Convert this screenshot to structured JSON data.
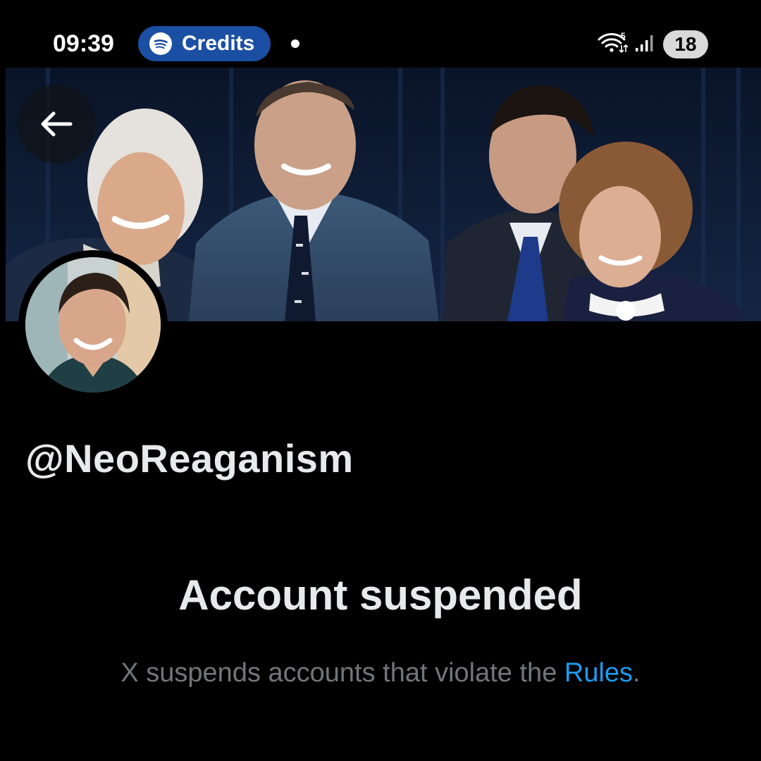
{
  "status_bar": {
    "time": "09:39",
    "media_pill_label": "Credits",
    "media_pill_icon": "spotify-icon",
    "network_label": "5",
    "battery_level": "18",
    "accent_color": "#1a4fa3"
  },
  "banner": {
    "back_icon": "arrow-left-icon"
  },
  "profile": {
    "handle": "@NeoReaganism"
  },
  "suspension": {
    "title": "Account suspended",
    "description_prefix": "X suspends accounts that violate the ",
    "rules_link": "Rules",
    "description_suffix": ".",
    "link_color": "#1d9bf0"
  }
}
